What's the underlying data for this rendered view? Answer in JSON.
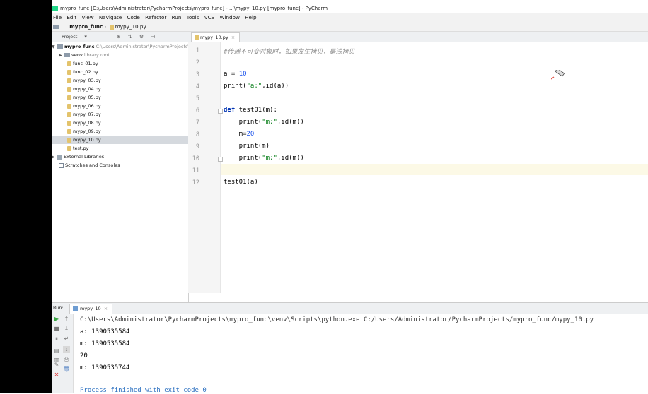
{
  "window": {
    "title": "mypro_func [C:\\Users\\Administrator\\PycharmProjects\\mypro_func] - ...\\mypy_10.py [mypro_func] - PyCharm"
  },
  "menu": [
    "File",
    "Edit",
    "View",
    "Navigate",
    "Code",
    "Refactor",
    "Run",
    "Tools",
    "VCS",
    "Window",
    "Help"
  ],
  "breadcrumb": {
    "project": "mypro_func",
    "file": "mypy_10.py"
  },
  "project_panel": {
    "title": "Project",
    "root_label": "mypro_func",
    "root_path": "C:\\Users\\Administrator\\PycharmProjects\\mypro_func",
    "venv_label": "venv",
    "venv_hint": "library root",
    "files": [
      "func_01.py",
      "func_02.py",
      "mypy_03.py",
      "mypy_04.py",
      "mypy_05.py",
      "mypy_06.py",
      "mypy_07.py",
      "mypy_08.py",
      "mypy_09.py",
      "mypy_10.py",
      "test.py"
    ],
    "external_libraries": "External Libraries",
    "scratches": "Scratches and Consoles",
    "selected_file": "mypy_10.py"
  },
  "editor": {
    "tab_label": "mypy_10.py",
    "line_numbers": [
      "1",
      "2",
      "3",
      "4",
      "5",
      "6",
      "7",
      "8",
      "9",
      "10",
      "11",
      "12"
    ],
    "current_line": 11,
    "code": {
      "l1": "#传递不可变对象时，如果发生拷贝，是浅拷贝",
      "l3_a": "a = ",
      "l3_b": "10",
      "l4_a": "print(",
      "l4_b": "\"a:\"",
      "l4_c": ",id(a))",
      "l6_a": "def",
      "l6_b": " test01(m):",
      "l7_a": "    print(",
      "l7_b": "\"m:\"",
      "l7_c": ",id(m))",
      "l8_a": "    m=",
      "l8_b": "20",
      "l9": "    print(m)",
      "l10_a": "    print(",
      "l10_b": "\"m:\"",
      "l10_c": ",id(m))",
      "l12": "test01(a)"
    }
  },
  "run_panel": {
    "label": "Run:",
    "tab_label": "mypy_10",
    "output": [
      "C:\\Users\\Administrator\\PycharmProjects\\mypro_func\\venv\\Scripts\\python.exe C:/Users/Administrator/PycharmProjects/mypro_func/mypy_10.py",
      "a: 1390535584",
      "m: 1390535584",
      "20",
      "m: 1390535744",
      "",
      "Process finished with exit code 0"
    ]
  },
  "colors": {
    "keyword": "#0033b3",
    "number": "#1750eb",
    "string": "#067d17",
    "comment": "#8c8c8c",
    "current_line_bg": "#fcf9e6",
    "selection_bg": "#d5d9de"
  }
}
